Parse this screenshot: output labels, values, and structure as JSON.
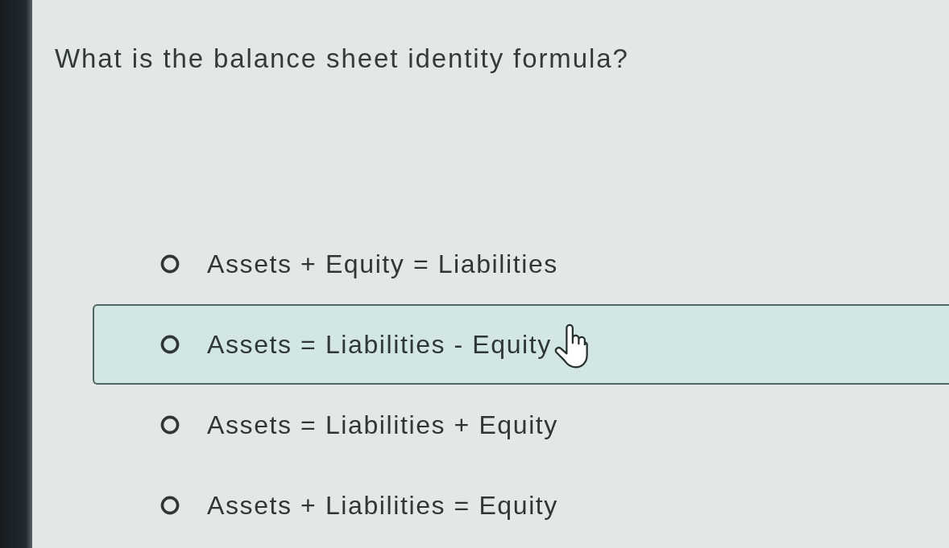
{
  "question": "What is the balance sheet identity formula?",
  "options": [
    {
      "label": "Assets + Equity = Liabilities",
      "selected": false,
      "hovered": false
    },
    {
      "label": "Assets = Liabilities - Equity",
      "selected": false,
      "hovered": true
    },
    {
      "label": "Assets = Liabilities + Equity",
      "selected": false,
      "hovered": false
    },
    {
      "label": "Assets + Liabilities = Equity",
      "selected": false,
      "hovered": false
    }
  ]
}
